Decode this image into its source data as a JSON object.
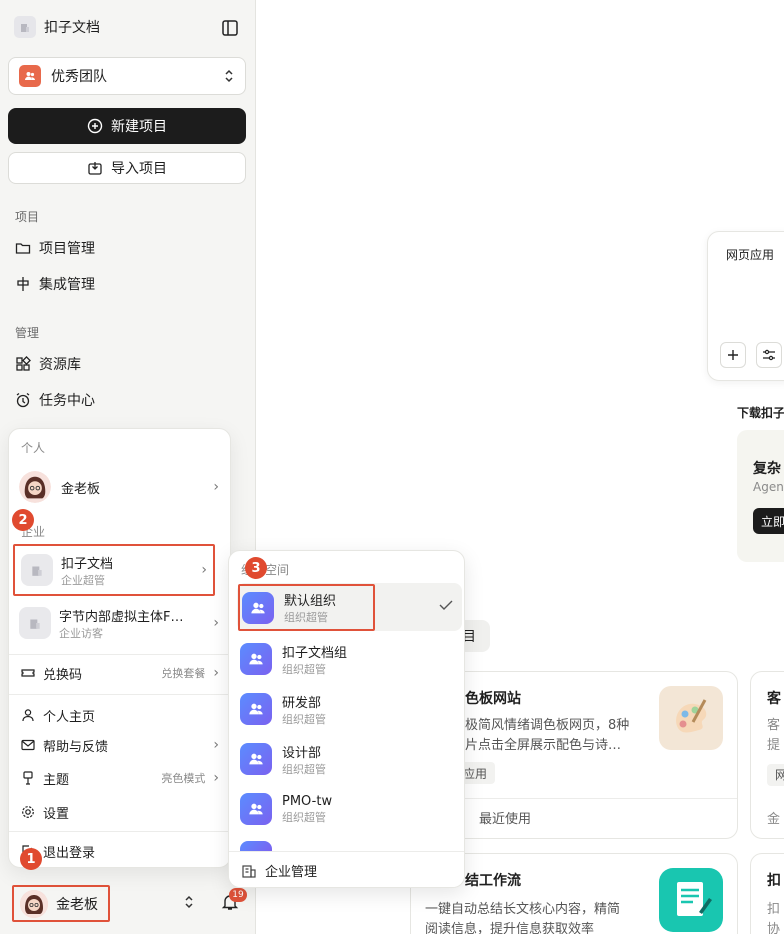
{
  "sidebar": {
    "app_name": "扣子文档",
    "team_name": "优秀团队",
    "new_project": "新建项目",
    "import_project": "导入项目",
    "section_project": "项目",
    "project_manage": "项目管理",
    "integration_manage": "集成管理",
    "section_manage": "管理",
    "resource_library": "资源库",
    "task_center": "任务中心",
    "user_name": "金老板",
    "notification_count": "19"
  },
  "menu": {
    "personal_label": "个人",
    "personal_name": "金老板",
    "enterprise_label": "企业",
    "orgs": [
      {
        "name": "扣子文档",
        "role": "企业超管"
      },
      {
        "name": "字节内部虚拟主体F…",
        "role": "企业访客"
      }
    ],
    "redeem": "兑换码",
    "redeem_hint": "兑换套餐",
    "homepage": "个人主页",
    "help": "帮助与反馈",
    "theme": "主题",
    "theme_value": "亮色模式",
    "settings": "设置",
    "logout": "退出登录"
  },
  "submenu": {
    "header": "组织空间",
    "items": [
      {
        "name": "默认组织",
        "role": "组织超管"
      },
      {
        "name": "扣子文档组",
        "role": "组织超管"
      },
      {
        "name": "研发部",
        "role": "组织超管"
      },
      {
        "name": "设计部",
        "role": "组织超管"
      },
      {
        "name": "PMO-tw",
        "role": "组织超管"
      }
    ],
    "footer": "企业管理"
  },
  "steps": [
    "1",
    "2",
    "3"
  ],
  "main": {
    "web_app_tag": "网页应用",
    "download_title": "下载扣子",
    "promo_title": "复杂",
    "promo_sub": "Agen",
    "promo_btn": "立即",
    "tab_label": "目",
    "card1": {
      "title": "色板网站",
      "desc1": "极简风情绪调色板网页，8种",
      "desc2": "片点击全屏展示配色与诗…",
      "tag": "应用",
      "footer": "最近使用"
    },
    "card2": {
      "title": "结工作流",
      "desc1": "一键自动总结长文核心内容，精简",
      "desc2": "阅读信息，提升信息获取效率"
    },
    "side_card1": {
      "title": "客",
      "l1": "客",
      "l2": "提",
      "tag": "网",
      "footer": "金"
    },
    "side_card2": {
      "title": "扣",
      "l1": "扣",
      "l2": "协"
    }
  }
}
